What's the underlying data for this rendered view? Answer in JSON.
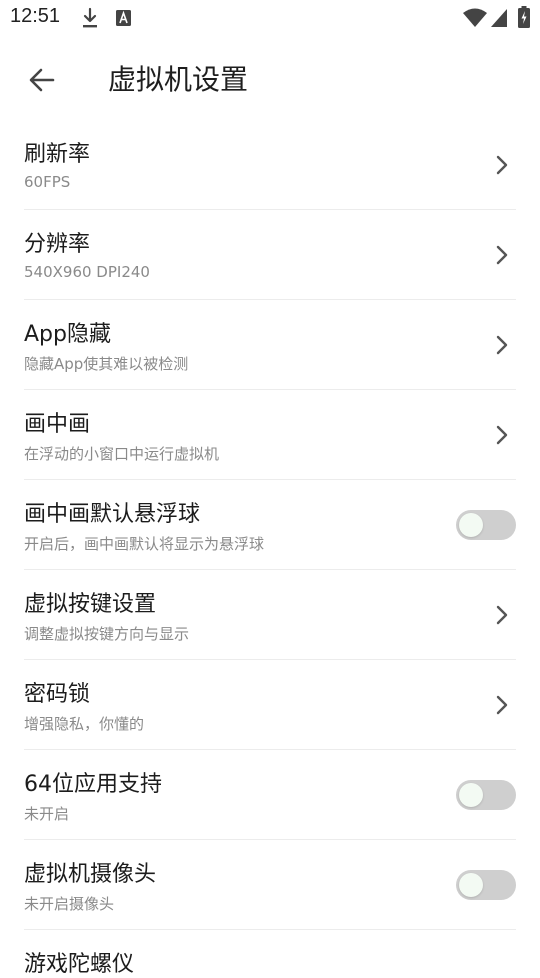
{
  "status_bar": {
    "time": "12:51",
    "icons": [
      "download-icon",
      "a-badge-icon",
      "wifi-icon",
      "signal-icon",
      "battery-icon"
    ]
  },
  "app_bar": {
    "back_icon": "arrow-left-icon",
    "title": "虚拟机设置"
  },
  "settings": [
    {
      "title": "刷新率",
      "subtitle": "60FPS",
      "control": "chevron"
    },
    {
      "title": "分辨率",
      "subtitle": "540X960 DPI240",
      "control": "chevron"
    },
    {
      "title": "App隐藏",
      "subtitle": "隐藏App使其难以被检测",
      "control": "chevron"
    },
    {
      "title": "画中画",
      "subtitle": "在浮动的小窗口中运行虚拟机",
      "control": "chevron"
    },
    {
      "title": "画中画默认悬浮球",
      "subtitle": "开启后，画中画默认将显示为悬浮球",
      "control": "toggle",
      "enabled": false
    },
    {
      "title": "虚拟按键设置",
      "subtitle": "调整虚拟按键方向与显示",
      "control": "chevron"
    },
    {
      "title": "密码锁",
      "subtitle": "增强隐私，你懂的",
      "control": "chevron"
    },
    {
      "title": "64位应用支持",
      "subtitle": "未开启",
      "control": "toggle",
      "enabled": false
    },
    {
      "title": "虚拟机摄像头",
      "subtitle": "未开启摄像头",
      "control": "toggle",
      "enabled": false
    },
    {
      "title": "游戏陀螺仪",
      "subtitle": "",
      "control": "partial"
    }
  ],
  "colors": {
    "toggle_track_off": "#cfcfcf",
    "toggle_knob_off": "#f3faf3",
    "subtitle": "#8a8a8a",
    "divider": "#ececec"
  }
}
